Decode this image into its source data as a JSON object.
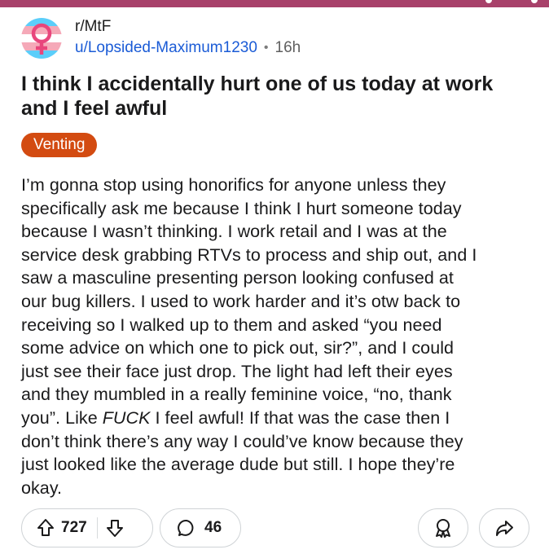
{
  "post": {
    "subreddit": "r/MtF",
    "author": "u/Lopsided-Maximum1230",
    "separator": "•",
    "age": "16h",
    "title_lines": [
      "I think I accidentally hurt one of us today at work",
      "and I feel awful"
    ],
    "flair": "Venting",
    "body_lines": [
      "I’m gonna stop using honorifics for anyone unless they",
      "specifically ask me because I think I hurt someone today",
      "because I wasn’t thinking. I work retail and I was at the",
      "service desk grabbing RTVs to process and ship out, and I",
      "saw a masculine presenting person looking confused at",
      "our bug killers. I used to work harder and it’s otw back to",
      "receiving so I walked up to them and asked “you need",
      "some advice on which one to pick out, sir?”, and I could",
      "just see their face just drop. The light had left their eyes",
      "and they mumbled in a really feminine voice, “no, thank",
      {
        "before": "you”. Like ",
        "emphasis": "FUCK",
        "after": " I feel awful! If that was the case then I"
      },
      "don’t think there’s any way I could’ve know because they",
      "just looked like the average dude but still. I hope they’re",
      "okay."
    ]
  },
  "actions": {
    "upvotes": "727",
    "comments": "46"
  },
  "icons": {
    "avatar": "trans-flag-female-symbol-icon",
    "upvote": "arrow-up-icon",
    "downvote": "arrow-down-icon",
    "comment": "speech-bubble-icon",
    "award": "award-icon",
    "share": "share-arrow-icon"
  },
  "colors": {
    "top_strip": "#a8416a",
    "username": "#1a5bd6",
    "flair_bg": "#d34b11",
    "flair_text": "#ffffff",
    "trans_blue": "#5bcefa",
    "trans_pink": "#f5a9b8",
    "symbol_pink": "#e8467c"
  }
}
